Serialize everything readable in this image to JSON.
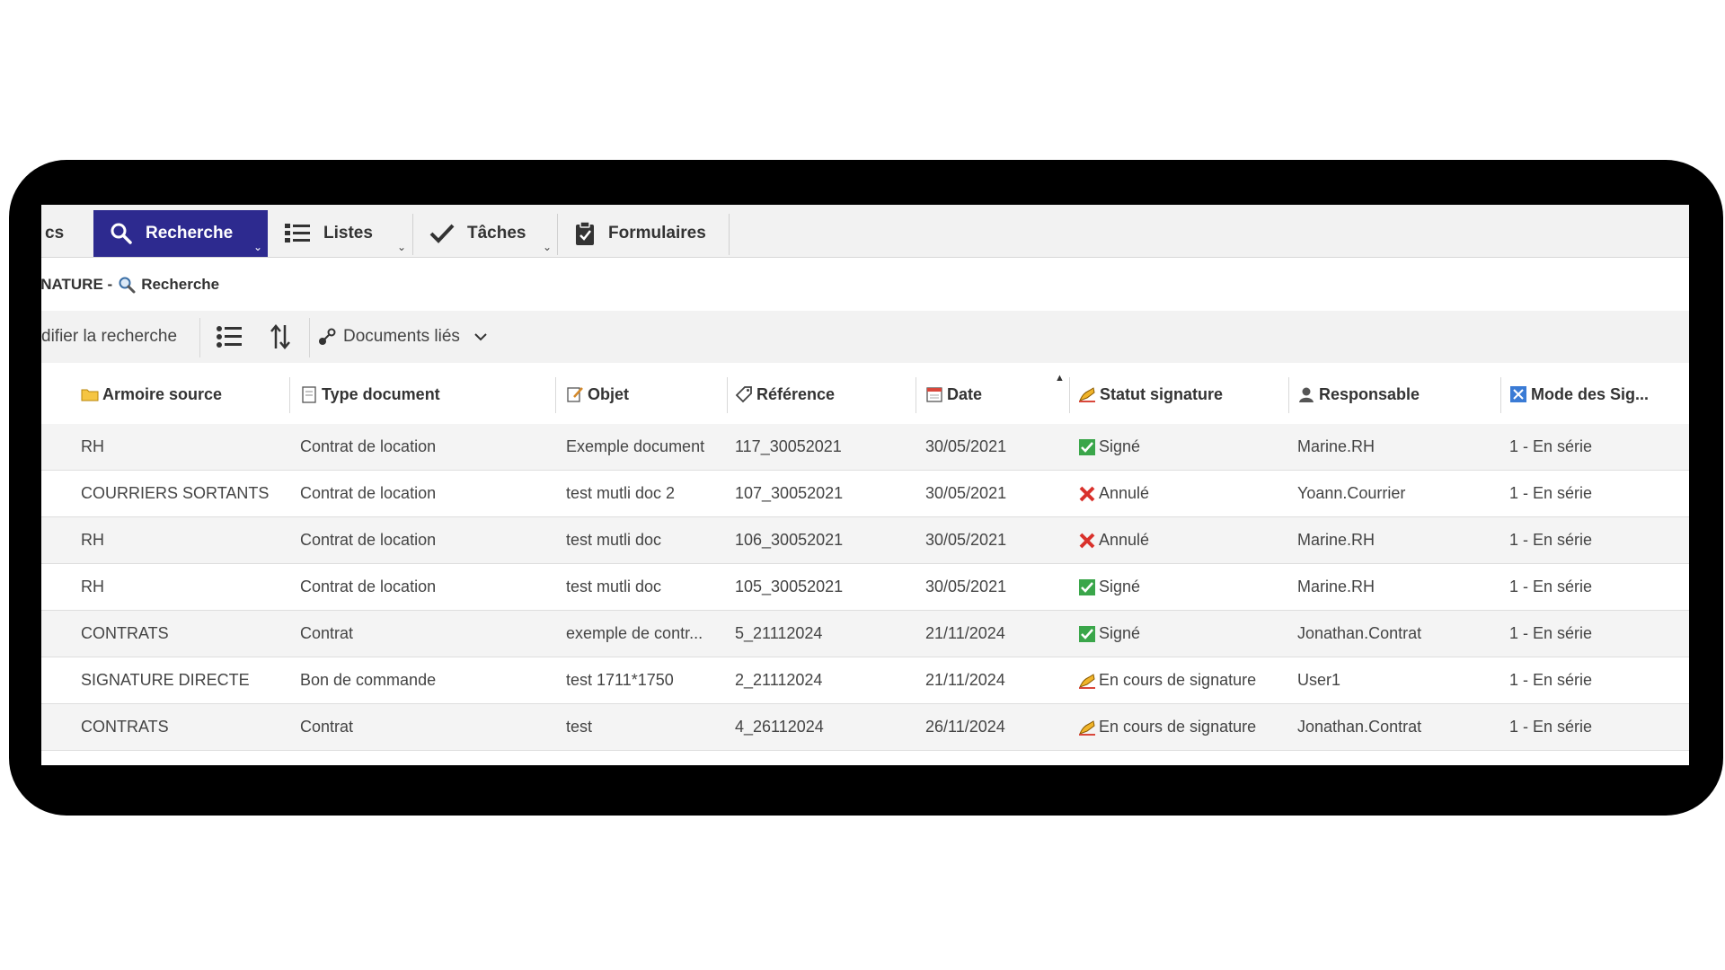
{
  "nav": {
    "tabs": [
      {
        "label": "cs",
        "icon": "truncated-tab"
      },
      {
        "label": "Recherche",
        "icon": "search-icon",
        "active": true
      },
      {
        "label": "Listes",
        "icon": "list-icon"
      },
      {
        "label": "Tâches",
        "icon": "check-icon"
      },
      {
        "label": "Formulaires",
        "icon": "clipboard-icon"
      }
    ]
  },
  "breadcrumb": {
    "prefix": "GNATURE -",
    "page": "Recherche"
  },
  "toolbar": {
    "modify_search": "difier la recherche",
    "linked_docs": "Documents liés"
  },
  "table": {
    "columns": [
      {
        "label": "Armoire source",
        "icon": "folder-icon"
      },
      {
        "label": "Type document",
        "icon": "document-icon"
      },
      {
        "label": "Objet",
        "icon": "edit-document-icon"
      },
      {
        "label": "Référence",
        "icon": "tag-icon"
      },
      {
        "label": "Date",
        "icon": "calendar-icon"
      },
      {
        "label": "Statut signature",
        "icon": "signature-icon"
      },
      {
        "label": "Responsable",
        "icon": "user-icon"
      },
      {
        "label": "Mode des Sig...",
        "icon": "mode-icon"
      }
    ],
    "rows": [
      {
        "armoire": "RH",
        "type": "Contrat de location",
        "objet": "Exemple document",
        "reference": "117_30052021",
        "date": "30/05/2021",
        "statut": "Signé",
        "statut_icon": "check-box-icon",
        "responsable": "Marine.RH",
        "mode": "1 - En série"
      },
      {
        "armoire": "COURRIERS SORTANTS",
        "type": "Contrat de location",
        "objet": "test mutli doc 2",
        "reference": "107_30052021",
        "date": "30/05/2021",
        "statut": "Annulé",
        "statut_icon": "cross-icon",
        "responsable": "Yoann.Courrier",
        "mode": "1 - En série"
      },
      {
        "armoire": "RH",
        "type": "Contrat de location",
        "objet": "test mutli doc",
        "reference": "106_30052021",
        "date": "30/05/2021",
        "statut": "Annulé",
        "statut_icon": "cross-icon",
        "responsable": "Marine.RH",
        "mode": "1 - En série"
      },
      {
        "armoire": "RH",
        "type": "Contrat de location",
        "objet": "test mutli doc",
        "reference": "105_30052021",
        "date": "30/05/2021",
        "statut": "Signé",
        "statut_icon": "check-box-icon",
        "responsable": "Marine.RH",
        "mode": "1 - En série"
      },
      {
        "armoire": "CONTRATS",
        "type": "Contrat",
        "objet": "exemple de contr...",
        "reference": "5_21112024",
        "date": "21/11/2024",
        "statut": "Signé",
        "statut_icon": "check-box-icon",
        "responsable": "Jonathan.Contrat",
        "mode": "1 - En série"
      },
      {
        "armoire": "SIGNATURE DIRECTE",
        "type": "Bon de commande",
        "objet": "test 1711*1750",
        "reference": "2_21112024",
        "date": "21/11/2024",
        "statut": "En cours de signature",
        "statut_icon": "signing-hand-icon",
        "responsable": "User1",
        "mode": "1 - En série"
      },
      {
        "armoire": "CONTRATS",
        "type": "Contrat",
        "objet": "test",
        "reference": "4_26112024",
        "date": "26/11/2024",
        "statut": "En cours de signature",
        "statut_icon": "signing-hand-icon",
        "responsable": "Jonathan.Contrat",
        "mode": "1 - En série"
      }
    ]
  }
}
